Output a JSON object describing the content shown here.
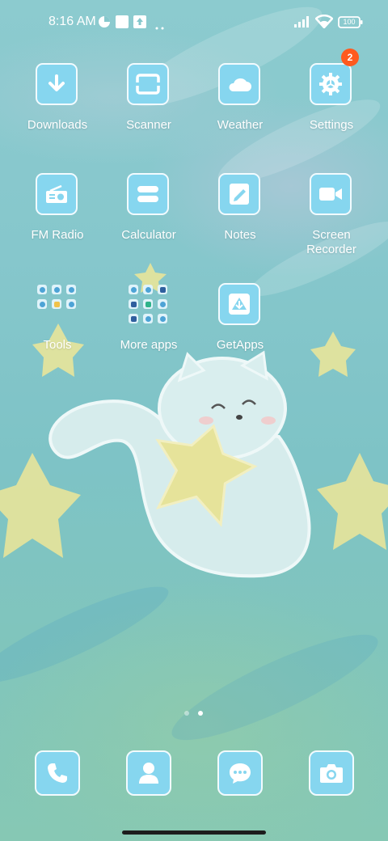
{
  "status_bar": {
    "time": "8:16 AM",
    "battery": "100",
    "icons": [
      "data-saver-icon",
      "notification-square-icon",
      "upload-box-icon",
      "more-dots-icon",
      "signal-icon",
      "wifi-icon",
      "battery-icon"
    ]
  },
  "apps": [
    {
      "label": "Downloads",
      "icon": "download-arrow-icon"
    },
    {
      "label": "Scanner",
      "icon": "scan-frame-icon"
    },
    {
      "label": "Weather",
      "icon": "cloud-icon"
    },
    {
      "label": "Settings",
      "icon": "gear-icon",
      "badge": "2"
    },
    {
      "label": "FM Radio",
      "icon": "radio-icon"
    },
    {
      "label": "Calculator",
      "icon": "calculator-icon"
    },
    {
      "label": "Notes",
      "icon": "note-pencil-icon"
    },
    {
      "label": "Screen\nRecorder",
      "icon": "video-camera-icon"
    },
    {
      "label": "Tools",
      "icon": "folder-icon"
    },
    {
      "label": "More apps",
      "icon": "folder-icon"
    },
    {
      "label": "GetApps",
      "icon": "store-icon"
    }
  ],
  "dock": [
    {
      "name": "phone",
      "icon": "phone-icon"
    },
    {
      "name": "contacts",
      "icon": "contact-person-icon"
    },
    {
      "name": "messages",
      "icon": "chat-bubble-icon"
    },
    {
      "name": "camera",
      "icon": "camera-icon"
    }
  ],
  "page_indicator": {
    "pages": 2,
    "current": 2
  },
  "colors": {
    "tile": "#86d6ef",
    "badge": "#ff5a1f",
    "star": "#e8e49a"
  }
}
